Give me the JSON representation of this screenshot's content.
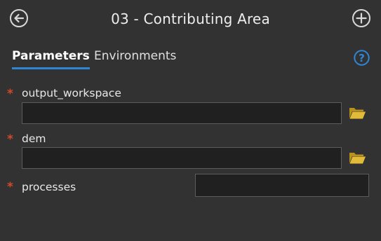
{
  "header": {
    "title": "03 - Contributing Area",
    "back_icon": "back-arrow-icon",
    "add_icon": "plus-circle-icon"
  },
  "tabs": [
    {
      "label": "Parameters",
      "active": true
    },
    {
      "label": "Environments",
      "active": false
    }
  ],
  "help_icon": "help-icon",
  "colors": {
    "accent": "#2f86d6",
    "required": "#d24a2a",
    "folder": "#d9b233",
    "background": "#323232",
    "field_bg": "#202020"
  },
  "parameters": [
    {
      "label": "output_workspace",
      "required_marker": "*",
      "value": "",
      "browse_icon": "folder-icon"
    },
    {
      "label": "dem",
      "required_marker": "*",
      "value": "",
      "browse_icon": "folder-icon"
    },
    {
      "label": "processes",
      "required_marker": "*",
      "value": ""
    }
  ]
}
